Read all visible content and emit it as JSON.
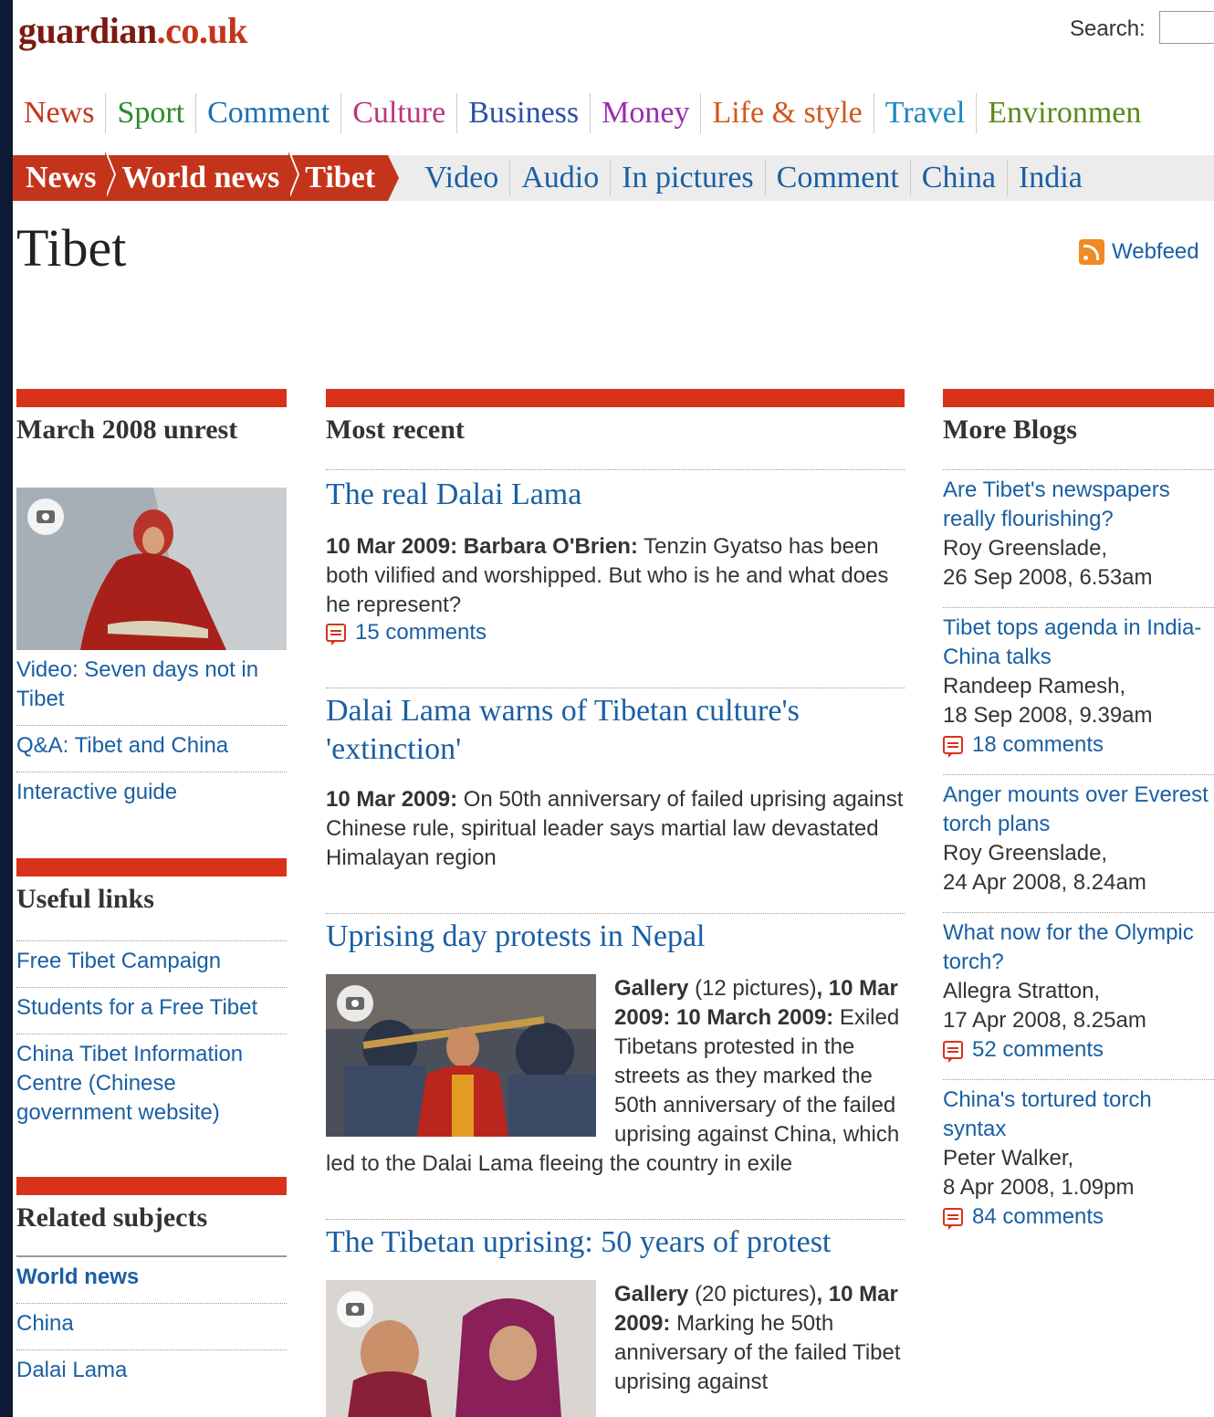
{
  "header": {
    "logo_main": "guardian",
    "logo_tld": ".co.uk",
    "search_label": "Search:"
  },
  "nav": [
    {
      "label": "News",
      "color": "#c4341b"
    },
    {
      "label": "Sport",
      "color": "#2a8a2a"
    },
    {
      "label": "Comment",
      "color": "#1a6fb0"
    },
    {
      "label": "Culture",
      "color": "#c0337a"
    },
    {
      "label": "Business",
      "color": "#2b4fa8"
    },
    {
      "label": "Money",
      "color": "#9a2bb0"
    },
    {
      "label": "Life & style",
      "color": "#d4571a"
    },
    {
      "label": "Travel",
      "color": "#1a86c0"
    },
    {
      "label": "Environmen",
      "color": "#5a8a1a"
    }
  ],
  "breadcrumb": [
    "News",
    "World news",
    "Tibet"
  ],
  "subnav": [
    "Video",
    "Audio",
    "In pictures",
    "Comment",
    "China",
    "India"
  ],
  "page_title": "Tibet",
  "webfeed_label": "Webfeed",
  "left": {
    "section1_title": "March 2008 unrest",
    "video_link": "Video: Seven days not in Tibet",
    "links1": [
      "Q&A: Tibet and China",
      "Interactive guide"
    ],
    "section2_title": "Useful links",
    "links2": [
      "Free Tibet Campaign",
      "Students for a Free Tibet",
      "China Tibet Information Centre (Chinese government website)"
    ],
    "section3_title": "Related subjects",
    "links3_bold": "World news",
    "links3": [
      "China",
      "Dalai Lama"
    ]
  },
  "center": {
    "title": "Most recent",
    "a1": {
      "headline": "The real Dalai Lama",
      "date": "10 Mar 2009:",
      "author": "Barbara O'Brien:",
      "text": "Tenzin Gyatso has been both vilified and worshipped. But who is he and what does he represent?",
      "comments": "15 comments"
    },
    "a2": {
      "headline": "Dalai Lama warns of Tibetan culture's 'extinction'",
      "date": "10 Mar 2009:",
      "text": "On 50th anniversary of failed uprising against Chinese rule, spiritual leader says martial law devastated Himalayan region"
    },
    "a3": {
      "headline": "Uprising day protests in Nepal",
      "gallery": "Gallery",
      "count": "(12 pictures)",
      "date": ", 10 Mar 2009: 10 March 2009:",
      "text": "Exiled Tibetans protested in the streets as they marked the 50th anniversary of the failed uprising against China, which led to the Dalai Lama fleeing the country in exile"
    },
    "a4": {
      "headline": "The Tibetan uprising: 50 years of protest",
      "gallery": "Gallery",
      "count": "(20 pictures)",
      "date": ", 10 Mar 2009:",
      "text": "Marking he 50th anniversary of the failed Tibet uprising against"
    }
  },
  "right": {
    "title": "More Blogs",
    "blogs": [
      {
        "title": "Are Tibet's newspapers really flourishing?",
        "author": "Roy Greenslade,",
        "date": "26 Sep 2008, 6.53am",
        "comments": ""
      },
      {
        "title": "Tibet tops agenda in India-China talks",
        "author": "Randeep Ramesh,",
        "date": "18 Sep 2008, 9.39am",
        "comments": "18 comments"
      },
      {
        "title": "Anger mounts over Everest torch plans",
        "author": "Roy Greenslade,",
        "date": "24 Apr 2008, 8.24am",
        "comments": ""
      },
      {
        "title": "What now for the Olympic torch?",
        "author": "Allegra Stratton,",
        "date": "17 Apr 2008, 8.25am",
        "comments": "52 comments"
      },
      {
        "title": "China's tortured torch syntax",
        "author": "Peter Walker,",
        "date": "8 Apr 2008, 1.09pm",
        "comments": "84 comments"
      }
    ]
  }
}
